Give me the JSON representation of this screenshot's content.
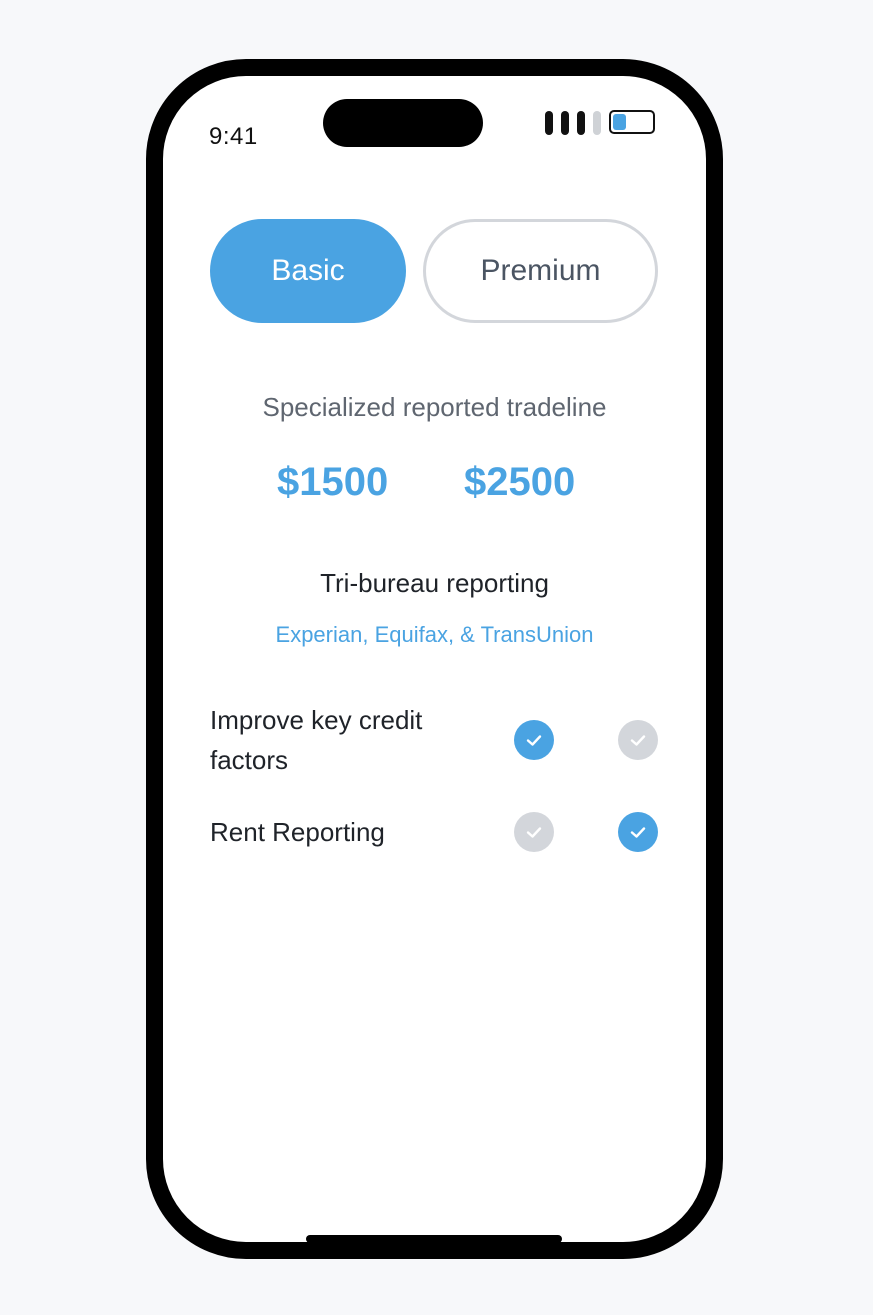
{
  "status_bar": {
    "time": "9:41",
    "battery_level": 0.35
  },
  "plan_tabs": {
    "selected": "Basic",
    "items": [
      {
        "label": "Basic",
        "active": true
      },
      {
        "label": "Premium",
        "active": false
      }
    ]
  },
  "plan": {
    "subtitle": "Specialized reported tradeline",
    "prices": [
      "$1500",
      "$2500"
    ]
  },
  "feature": {
    "title": "Tri-bureau reporting",
    "bureaus": "Experian, Equifax, & TransUnion"
  },
  "comparison_rows": [
    {
      "label": "Improve key credit factors",
      "basic": true,
      "premium": false
    },
    {
      "label": "Rent Reporting",
      "basic": false,
      "premium": true
    }
  ],
  "colors": {
    "accent": "#4aa3e2",
    "inactive": "#d3d6db",
    "text": "#1f2329",
    "muted": "#5f6670"
  },
  "icons": {
    "check": "checkmark-icon"
  }
}
